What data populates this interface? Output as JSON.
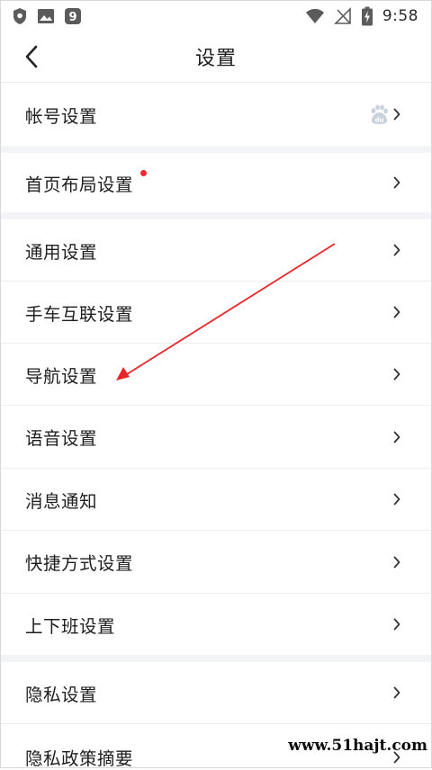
{
  "status_bar": {
    "time": "9:58",
    "left_icons": [
      "shield-icon",
      "image-icon",
      "app-9-icon"
    ],
    "right_icons": [
      "wifi-icon",
      "no-signal-icon",
      "battery-charging-icon"
    ]
  },
  "nav": {
    "title": "设置",
    "back_icon": "chevron-left-icon"
  },
  "settings": {
    "account": {
      "label": "帐号设置",
      "icon": "baidu-paw-icon"
    },
    "home_layout": {
      "label": "首页布局设置",
      "has_red_dot": true
    },
    "general": {
      "label": "通用设置"
    },
    "car_link": {
      "label": "手车互联设置"
    },
    "navigation": {
      "label": "导航设置"
    },
    "voice": {
      "label": "语音设置"
    },
    "notifications": {
      "label": "消息通知"
    },
    "shortcuts": {
      "label": "快捷方式设置"
    },
    "commute": {
      "label": "上下班设置"
    },
    "privacy": {
      "label": "隐私设置"
    },
    "privacy_policy": {
      "label": "隐私政策摘要"
    }
  },
  "annotation": {
    "color": "#e8262a"
  },
  "watermark": {
    "text": "www.51hajt.com"
  },
  "colors": {
    "divider": "#eeeeee",
    "section_gap": "#f3f4f6",
    "red_dot": "#ea2a2a"
  }
}
